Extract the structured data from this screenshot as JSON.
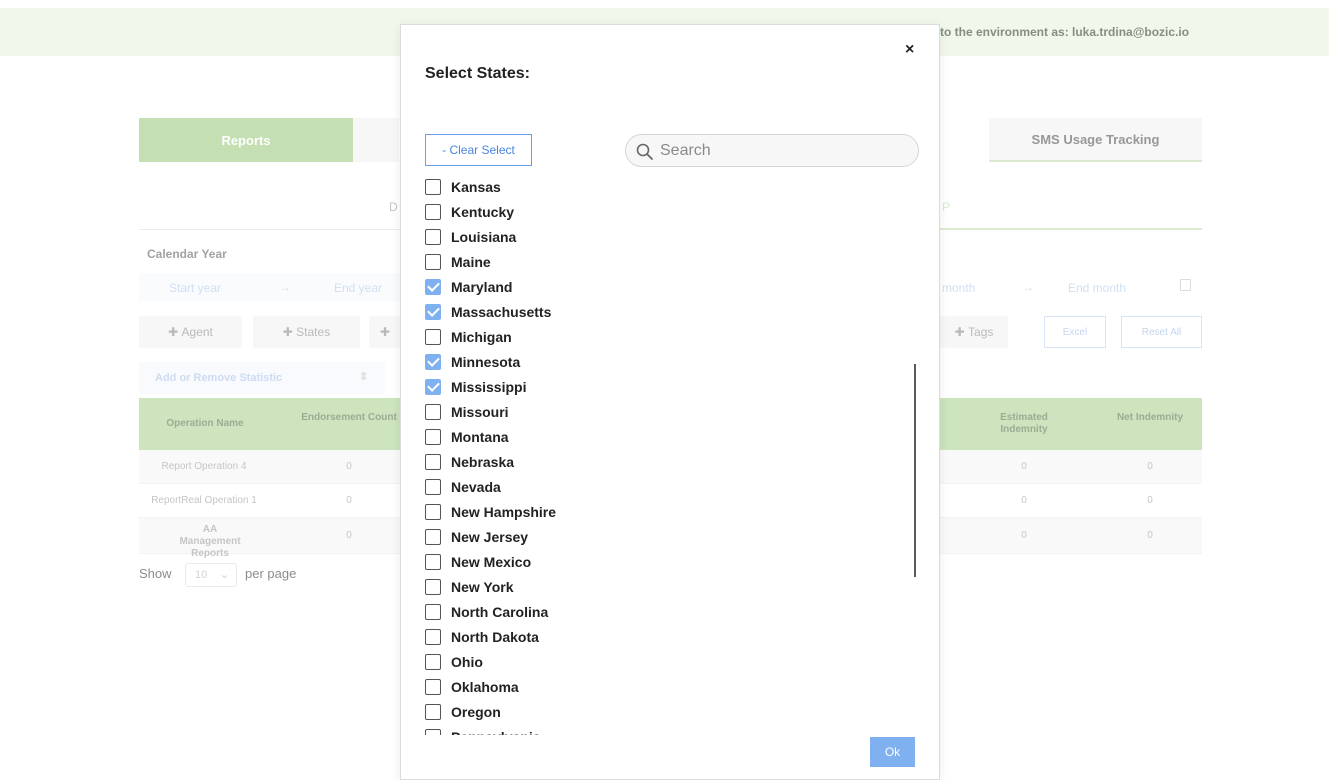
{
  "background": {
    "banner_text": "to the environment as: luka.trdina@bozic.io",
    "tabs": {
      "active_label": "Reports",
      "sms_label": "SMS Usage Tracking"
    },
    "subtab_fragment_left": "D",
    "subtab_fragment_right": "P",
    "calendar_label": "Calendar Year",
    "year_range": {
      "start": "Start year",
      "arrow": "→",
      "end": "End year"
    },
    "month_range": {
      "start": "month",
      "arrow": "→",
      "end": "End month"
    },
    "filters": {
      "agent": "Agent",
      "states": "States",
      "tags": "Tags",
      "excel": "Excel",
      "reset": "Reset All"
    },
    "statistic_select": "Add or Remove Statistic",
    "table": {
      "headers_left": [
        "Operation Name",
        "Endorsement Count"
      ],
      "headers_right": [
        "Estimated Indemnity",
        "Net Indemnity"
      ],
      "rows": [
        {
          "name": "Report Operation 4",
          "count": "0",
          "estimated": "0",
          "net": "0"
        },
        {
          "name": "ReportReal Operation 1",
          "count": "0",
          "estimated": "0",
          "net": "0"
        },
        {
          "name": "AA Management Reports",
          "count": "0",
          "estimated": "0",
          "net": "0"
        }
      ]
    },
    "pager": {
      "show_label": "Show",
      "per_page_value": "10",
      "per_page_label": "per page"
    }
  },
  "modal": {
    "title": "Select States:",
    "close_label": "×",
    "clear_select_label": "- Clear Select",
    "search_placeholder": "Search",
    "ok_label": "Ok",
    "states": [
      {
        "name": "Kansas",
        "checked": false
      },
      {
        "name": "Kentucky",
        "checked": false
      },
      {
        "name": "Louisiana",
        "checked": false
      },
      {
        "name": "Maine",
        "checked": false
      },
      {
        "name": "Maryland",
        "checked": true
      },
      {
        "name": "Massachusetts",
        "checked": true
      },
      {
        "name": "Michigan",
        "checked": false
      },
      {
        "name": "Minnesota",
        "checked": true
      },
      {
        "name": "Mississippi",
        "checked": true
      },
      {
        "name": "Missouri",
        "checked": false
      },
      {
        "name": "Montana",
        "checked": false
      },
      {
        "name": "Nebraska",
        "checked": false
      },
      {
        "name": "Nevada",
        "checked": false
      },
      {
        "name": "New Hampshire",
        "checked": false
      },
      {
        "name": "New Jersey",
        "checked": false
      },
      {
        "name": "New Mexico",
        "checked": false
      },
      {
        "name": "New York",
        "checked": false
      },
      {
        "name": "North Carolina",
        "checked": false
      },
      {
        "name": "North Dakota",
        "checked": false
      },
      {
        "name": "Ohio",
        "checked": false
      },
      {
        "name": "Oklahoma",
        "checked": false
      },
      {
        "name": "Oregon",
        "checked": false
      },
      {
        "name": "Pennsylvania",
        "checked": false
      }
    ]
  },
  "colors": {
    "accent_green": "#a8d08d",
    "accent_blue": "#7fb0ef",
    "link_blue": "#4a84e0"
  }
}
